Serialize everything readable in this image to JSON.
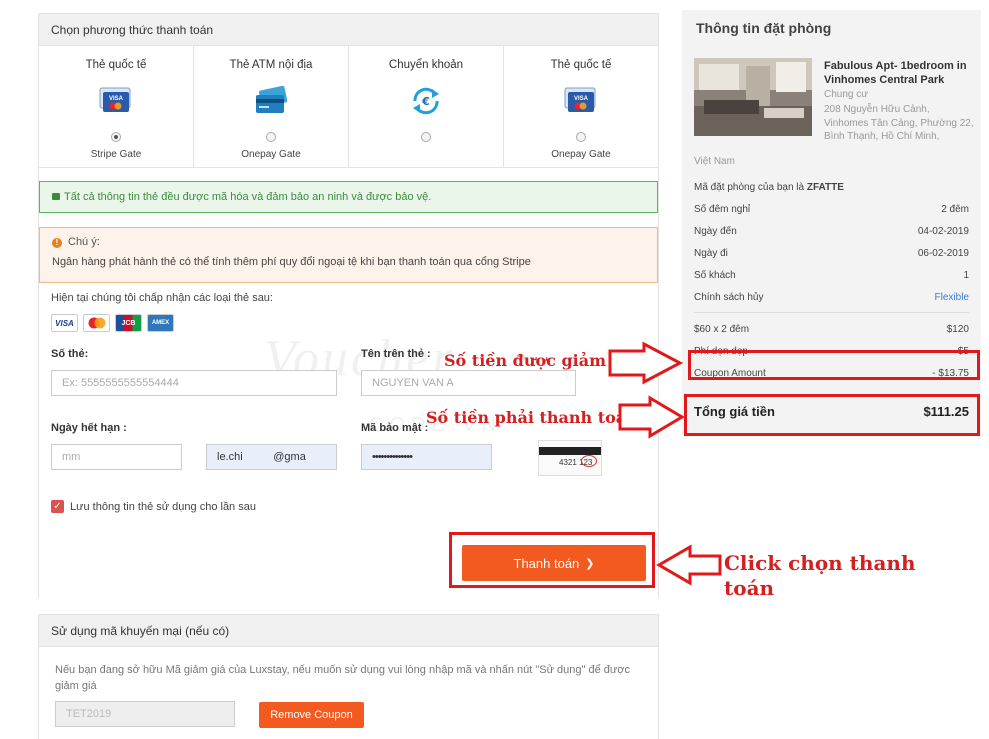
{
  "payment": {
    "header": "Chọn phương thức thanh toán",
    "methods": [
      {
        "title": "Thẻ quốc tế",
        "gate": "Stripe Gate",
        "icon": "visa-card-icon",
        "selected": true
      },
      {
        "title": "Thẻ ATM nội địa",
        "gate": "Onepay Gate",
        "icon": "atm-card-icon",
        "selected": false
      },
      {
        "title": "Chuyển khoản",
        "gate": "",
        "icon": "euro-transfer-icon",
        "selected": false
      },
      {
        "title": "Thẻ quốc tế",
        "gate": "Onepay Gate",
        "icon": "visa-card-icon",
        "selected": false
      }
    ],
    "secure_note": "Tất cả thông tin thẻ đều được mã hóa và đảm bảo an ninh và được bảo vệ.",
    "notice_title": "Chú ý:",
    "notice_text": "Ngân hàng phát hành thẻ có thể tính thêm phí quy đổi ngoại tệ khi bạn thanh toán qua cổng Stripe",
    "accept_label": "Hiện tại chúng tôi chấp nhận các loại thẻ sau:",
    "card_types": [
      "VISA",
      "MC",
      "JCB",
      "AMEX"
    ],
    "card_number_label": "Số thẻ:",
    "card_number_placeholder": "Ex: 5555555555554444",
    "card_name_label": "Tên trên thẻ :",
    "card_name_placeholder": "NGUYEN VAN A",
    "expiry_label": "Ngày hết hạn :",
    "expiry_placeholder": "mm",
    "email_value": "le.chi          @gma",
    "cvv_label": "Mã bảo mật :",
    "cvv_value": "••••••••••••••",
    "cvv_sample_number": "4321",
    "cvv_sample_code": "123",
    "save_card_label": "Lưu thông tin thẻ sử dụng cho lần sau",
    "pay_button": "Thanh toán",
    "pay_button_chevron": "❯"
  },
  "coupon": {
    "header": "Sử dụng mã khuyến mại (nếu có)",
    "description": "Nếu bạn đang sở hữu Mã giảm giá của Luxstay, nếu muốn sử dụng vui lòng nhập mã và nhấn nút \"Sử dụng\" để được giảm giá",
    "code": "TET2019",
    "remove_button": "Remove Coupon"
  },
  "booking": {
    "header": "Thông tin đặt phòng",
    "property_name": "Fabulous Apt- 1bedroom in Vinhomes Central Park",
    "property_type": "Chung cư",
    "address": "208 Nguyễn Hữu Cảnh, Vinhomes Tân Cảng, Phường 22, Bình Thạnh, Hồ Chí Minh,",
    "country": "Việt Nam",
    "code_label": "Mã đặt phòng của bạn là",
    "code": "ZFATTE",
    "rows": [
      {
        "label": "Số đêm nghỉ",
        "value": "2  đêm"
      },
      {
        "label": "Ngày đến",
        "value": "04-02-2019"
      },
      {
        "label": "Ngày đi",
        "value": "06-02-2019"
      },
      {
        "label": "Số khách",
        "value": "1"
      },
      {
        "label": "Chính sách hủy",
        "value": "Flexible"
      }
    ],
    "price_rows": [
      {
        "label": "$60 x 2  đêm",
        "value": "$120"
      },
      {
        "label": "Phí dọn dẹp",
        "value": "$5"
      },
      {
        "label": "Coupon Amount",
        "value": "- $13.75"
      }
    ],
    "total_label": "Tổng giá tiền",
    "total_value": "$111.25"
  },
  "annotations": {
    "discount": "Số tiền được giảm",
    "to_pay": "Số tiền phải thanh toán",
    "click_pay": "Click chọn thanh toán",
    "color": "#e0191c"
  },
  "watermark": {
    "script": "Voucher",
    "sub": "CODE.VN"
  }
}
